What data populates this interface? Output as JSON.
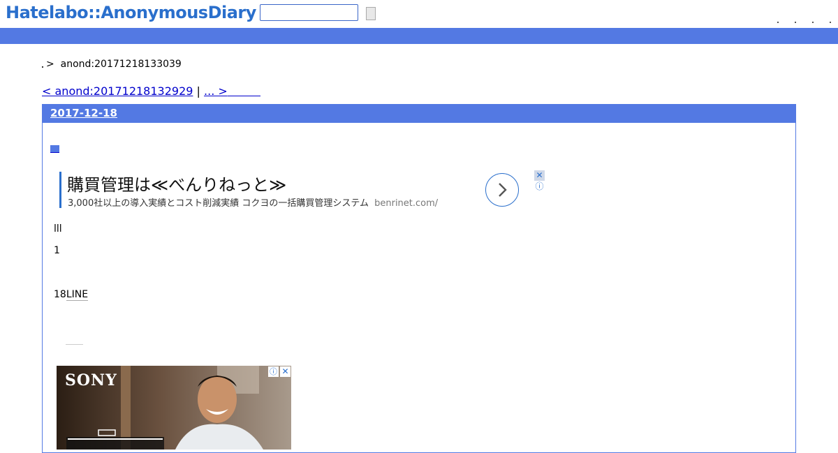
{
  "header": {
    "logo": "Hatelabo::AnonymousDiary",
    "search_value": "",
    "header_links": [
      "·",
      "·",
      "·",
      "·"
    ]
  },
  "breadcrumb": {
    "separator": ">",
    "current": "anond:20171218133039"
  },
  "pager": {
    "prev": "< anond:20171218132929",
    "divider": "|",
    "next": "... >"
  },
  "day": {
    "date": "2017-12-18",
    "entry_anchor": "■"
  },
  "text_ad": {
    "title": "購買管理は≪べんりねっと≫",
    "description": "3,000社以上の導入実績とコスト削減実績 コクヨの一括購買管理システム",
    "url": "benrinet.com/",
    "close": "✕",
    "info": "ⓘ"
  },
  "body": {
    "line1": "lll",
    "line2": "1",
    "line3_prefix": "18",
    "line3_link": "LINE"
  },
  "image_ad": {
    "brand": "SONY",
    "info": "ⓘ",
    "close": "✕"
  },
  "colors": {
    "accent": "#5379e3",
    "logo": "#2a6fcc",
    "link": "#0000cc"
  }
}
